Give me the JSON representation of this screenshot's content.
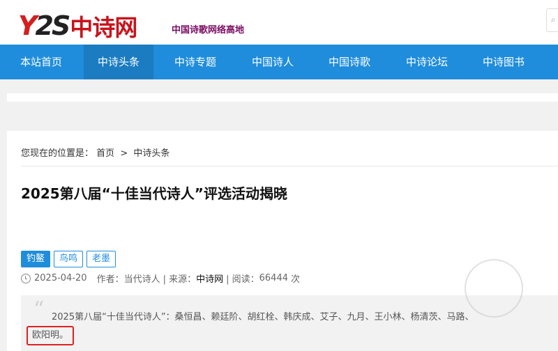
{
  "header": {
    "logo_y": "Y",
    "logo_2": "2",
    "logo_s": "S",
    "logo_cn": "中诗网",
    "slogan": "中国诗歌网络高地"
  },
  "nav": {
    "items": [
      {
        "label": "本站首页"
      },
      {
        "label": "中诗头条"
      },
      {
        "label": "中诗专题"
      },
      {
        "label": "中国诗人"
      },
      {
        "label": "中国诗歌"
      },
      {
        "label": "中诗论坛"
      },
      {
        "label": "中诗图书"
      }
    ]
  },
  "breadcrumb": {
    "prefix": "您现在的位置是：",
    "home": "首页",
    "separator": ">",
    "current": "中诗头条"
  },
  "article": {
    "title": "2025第八届“十佳当代诗人”评选活动揭晓",
    "tags": [
      "钓鳌",
      "鸟鸣",
      "老墨"
    ],
    "date": "2025-04-20",
    "author_label": "作者：当代诗人",
    "source_label": "| 来源：",
    "source": "中诗网",
    "reads_label": "| 阅读：",
    "reads": "66444",
    "reads_unit": "次",
    "quote_line1": "2025第八届“十佳当代诗人”：桑恒昌、赖廷阶、胡红栓、韩庆成、艾子、九月、王小林、杨清茨、马路、",
    "quote_line2": "欧阳明。"
  },
  "colors": {
    "nav_bg": "#1f8ddb",
    "nav_active": "#1b7cc2",
    "logo_red": "#c8141c",
    "slogan": "#7a0c63",
    "highlight_border": "#e02020"
  }
}
